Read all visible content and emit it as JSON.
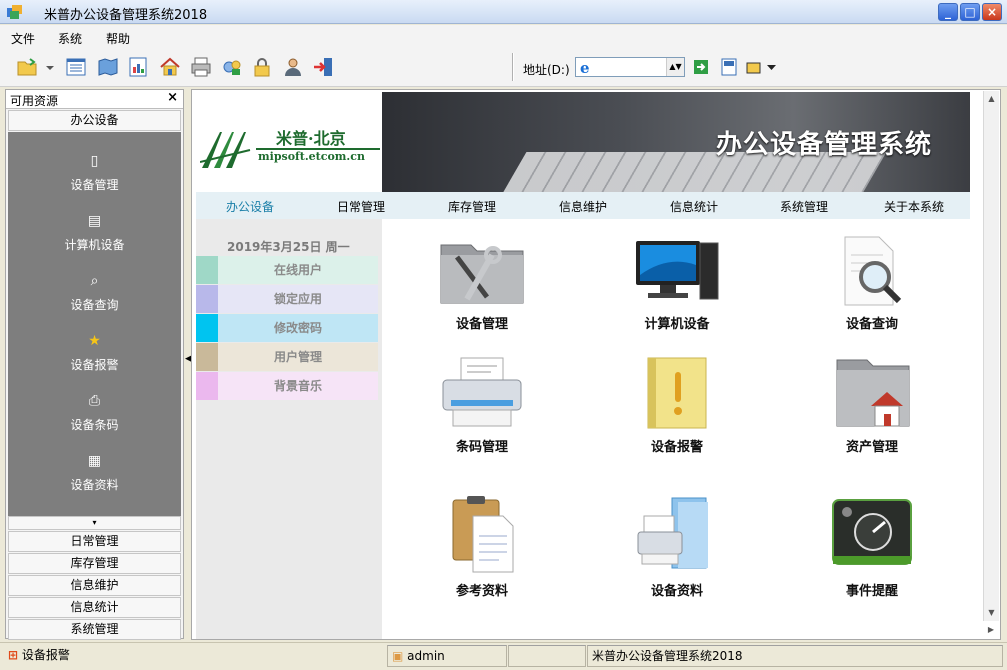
{
  "window": {
    "title": "米普办公设备管理系统2018"
  },
  "menu": [
    "文件",
    "系统",
    "帮助"
  ],
  "toolbar": {
    "icons": [
      "open-folder-icon",
      "dropdown-arrow-icon",
      "list-view-icon",
      "map-icon",
      "report-icon",
      "home-icon",
      "print-icon",
      "tools-icon",
      "lock-icon",
      "user-icon",
      "exit-icon",
      "go-icon",
      "save-icon",
      "options-icon"
    ],
    "address_label": "地址(D:)",
    "address_value": ""
  },
  "sidebar": {
    "title": "可用资源",
    "close": "×",
    "active_section": "办公设备",
    "items": [
      {
        "label": "设备管理",
        "icon": "document-icon"
      },
      {
        "label": "计算机设备",
        "icon": "clipboard-icon"
      },
      {
        "label": "设备查询",
        "icon": "magnifier-icon"
      },
      {
        "label": "设备报警",
        "icon": "star-icon"
      },
      {
        "label": "设备条码",
        "icon": "printer-icon"
      },
      {
        "label": "设备资料",
        "icon": "table-icon"
      }
    ],
    "more": "▾",
    "sections": [
      "日常管理",
      "库存管理",
      "信息维护",
      "信息统计",
      "系统管理"
    ]
  },
  "banner": {
    "logo_cn": "米普·北京",
    "logo_en": "mipsoft.etcom.cn",
    "title": "办公设备管理系统"
  },
  "nav": [
    "办公设备",
    "日常管理",
    "库存管理",
    "信息维护",
    "信息统计",
    "系统管理",
    "关于本系统"
  ],
  "nav_active_color": "#1a7fa8",
  "leftcol": {
    "date": "2019年3月25日  周一",
    "links": [
      {
        "label": "在线用户",
        "color": "#9fd8c7",
        "bg": "#dcf1ea"
      },
      {
        "label": "锁定应用",
        "color": "#b8b8ea",
        "bg": "#e6e6f6"
      },
      {
        "label": "修改密码",
        "color": "#00c4f0",
        "bg": "#bfe6f5"
      },
      {
        "label": "用户管理",
        "color": "#c9b99a",
        "bg": "#ece6d9"
      },
      {
        "label": "背景音乐",
        "color": "#ebb8ee",
        "bg": "#f6e4f7"
      }
    ]
  },
  "tiles": [
    {
      "label": "设备管理",
      "icon": "tools-folder-icon"
    },
    {
      "label": "计算机设备",
      "icon": "computer-icon"
    },
    {
      "label": "设备查询",
      "icon": "search-document-icon"
    },
    {
      "label": "条码管理",
      "icon": "printer-icon"
    },
    {
      "label": "设备报警",
      "icon": "alert-notebook-icon"
    },
    {
      "label": "资产管理",
      "icon": "home-folder-icon"
    },
    {
      "label": "参考资料",
      "icon": "clipboard-icon"
    },
    {
      "label": "设备资料",
      "icon": "fax-folder-icon"
    },
    {
      "label": "事件提醒",
      "icon": "gauge-icon"
    }
  ],
  "status": {
    "left": "设备报警",
    "user": "admin",
    "app": "米普办公设备管理系统2018"
  }
}
